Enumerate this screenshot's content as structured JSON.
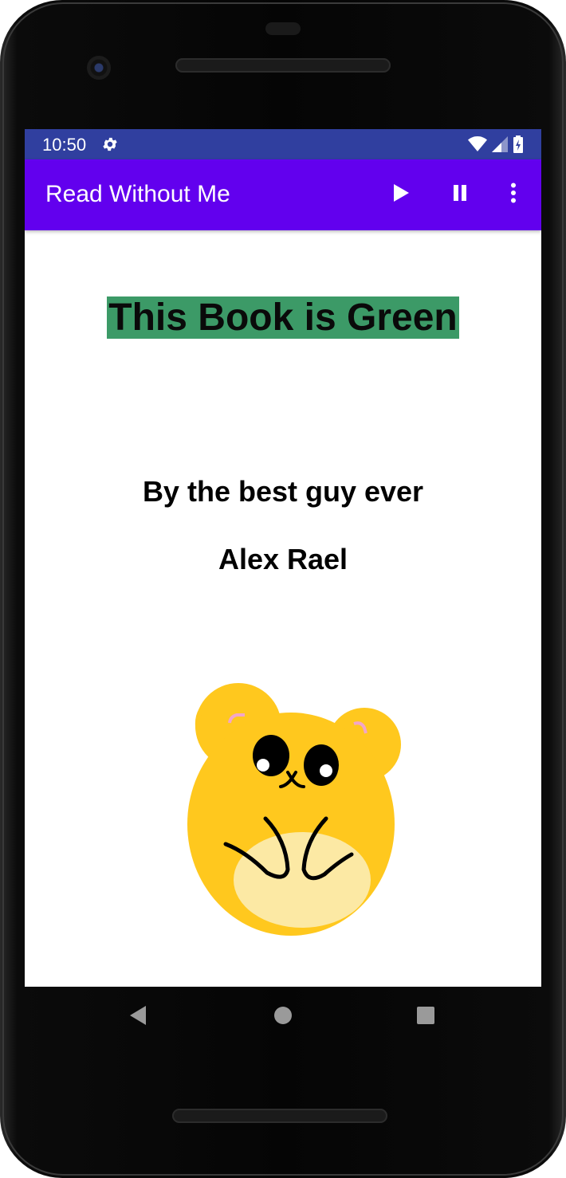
{
  "status_bar": {
    "time": "10:50",
    "background": "#303f9f"
  },
  "app_bar": {
    "title": "Read Without Me",
    "background": "#6200ee",
    "actions": [
      "play-icon",
      "pause-icon",
      "more-vert-icon"
    ]
  },
  "book": {
    "title": "This Book is Green",
    "title_highlight": "#3c9a67",
    "byline": "By the best guy ever",
    "author": "Alex Rael"
  },
  "navigation_bar": {
    "buttons": [
      "back-icon",
      "home-icon",
      "recents-icon"
    ]
  }
}
